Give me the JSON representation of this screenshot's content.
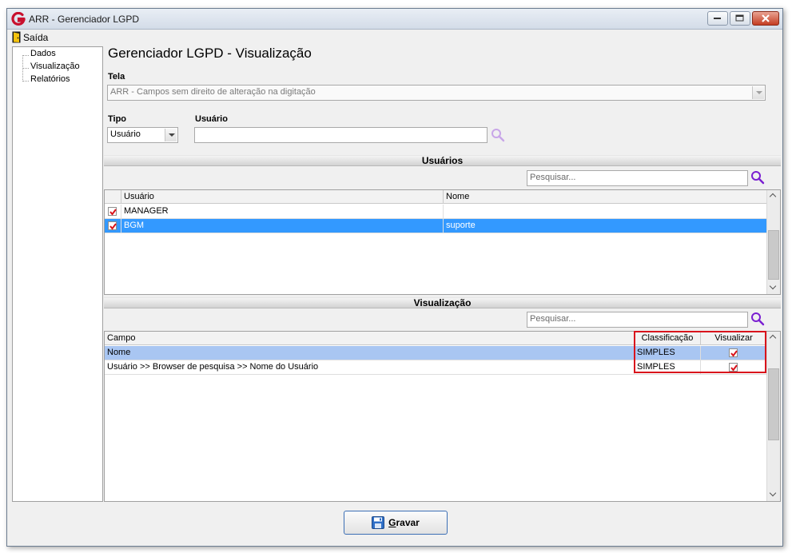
{
  "window": {
    "title": "ARR - Gerenciador LGPD"
  },
  "menu": {
    "exit_label": "Saída"
  },
  "tree": {
    "items": [
      {
        "label": "Dados"
      },
      {
        "label": "Visualização"
      },
      {
        "label": "Relatórios"
      }
    ]
  },
  "page": {
    "title": "Gerenciador LGPD - Visualização"
  },
  "form": {
    "tela_label": "Tela",
    "tela_value": "ARR - Campos sem direito de alteração na digitação",
    "tipo_label": "Tipo",
    "tipo_value": "Usuário",
    "usuario_label": "Usuário",
    "usuario_value": ""
  },
  "users_section": {
    "title": "Usuários",
    "search_placeholder": "Pesquisar...",
    "columns": [
      "Usuário",
      "Nome"
    ],
    "rows": [
      {
        "checked": true,
        "user": "MANAGER",
        "name": ""
      },
      {
        "checked": true,
        "user": "BGM",
        "name": "suporte",
        "selected": true
      }
    ]
  },
  "view_section": {
    "title": "Visualização",
    "search_placeholder": "Pesquisar...",
    "columns": [
      "Campo",
      "Classificação",
      "Visualizar"
    ],
    "rows": [
      {
        "campo": "Nome",
        "classificacao": "SIMPLES",
        "visualizar": true,
        "selected": true
      },
      {
        "campo": "Usuário >> Browser de pesquisa >> Nome do Usuário",
        "classificacao": "SIMPLES",
        "visualizar": true
      }
    ]
  },
  "actions": {
    "save_mnemonic": "G",
    "save_rest": "ravar"
  },
  "colors": {
    "selection": "#3399ff",
    "selection_soft": "#a9c6f2",
    "highlight": "#d9141c",
    "search_icon": "#7a1fd1"
  }
}
